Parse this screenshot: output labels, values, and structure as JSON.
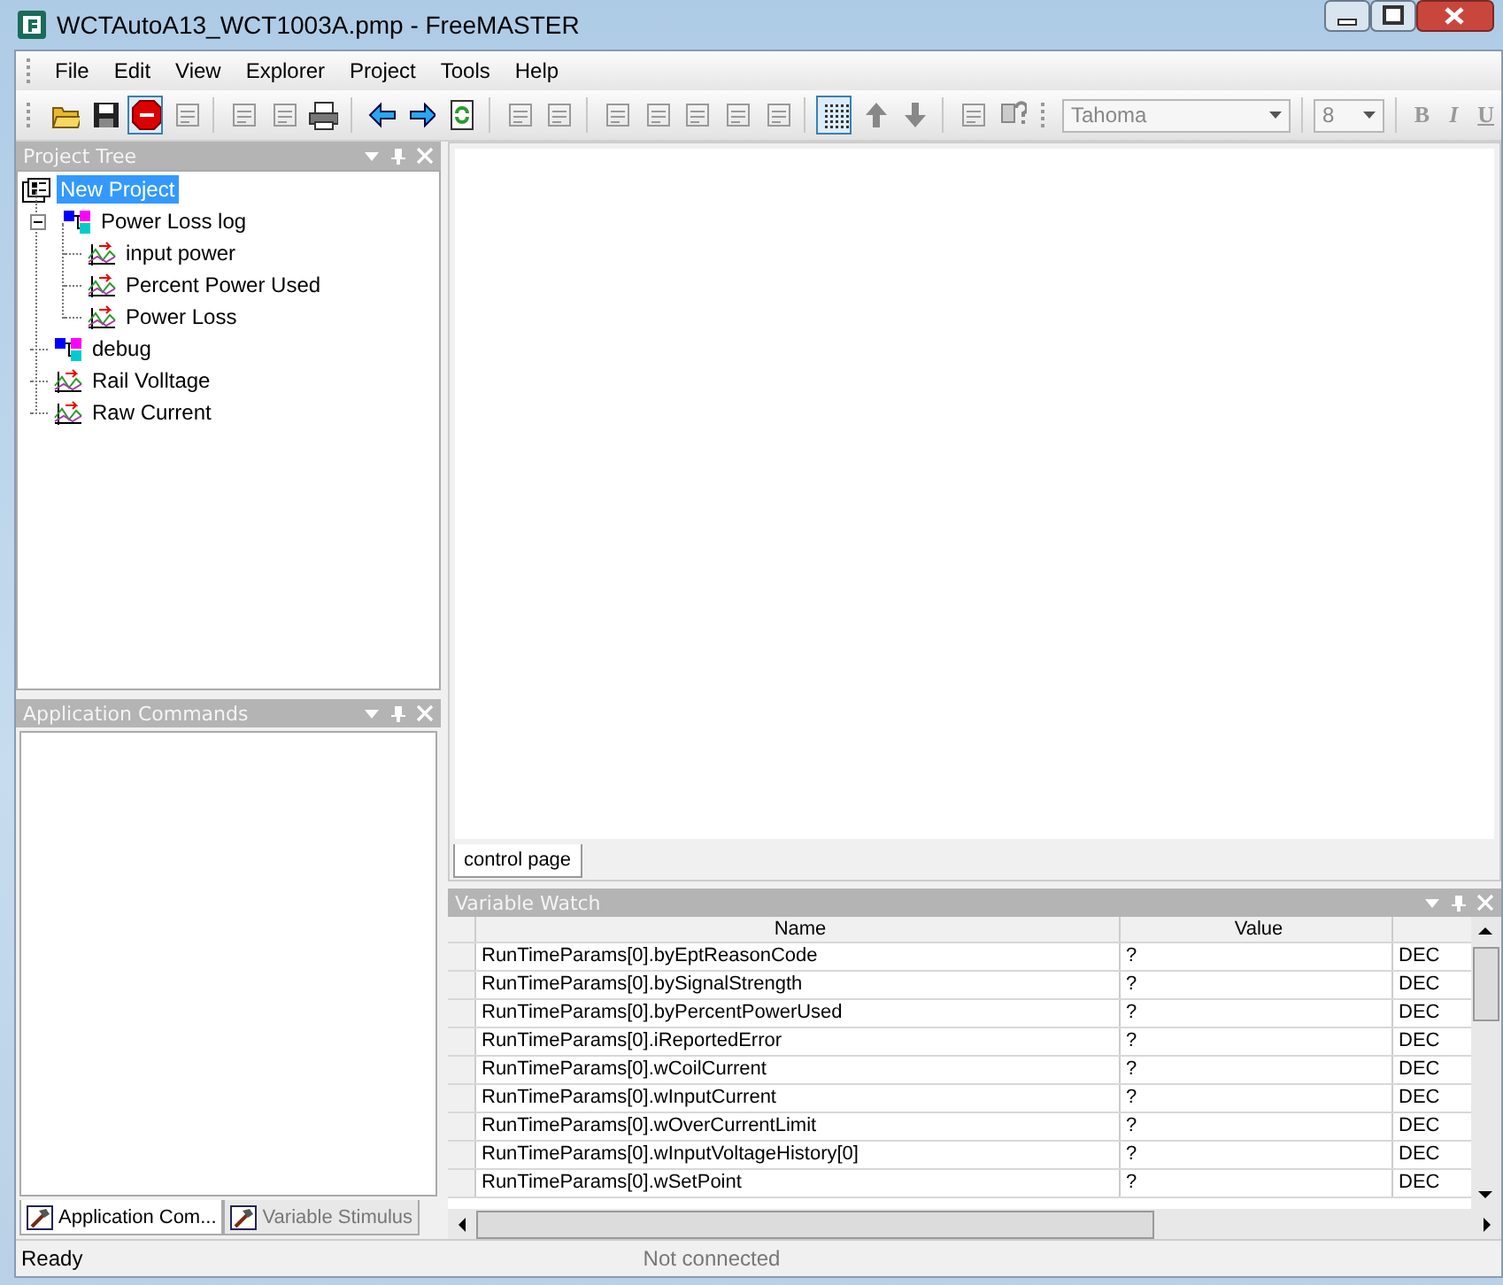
{
  "window": {
    "title": "WCTAutoA13_WCT1003A.pmp - FreeMASTER"
  },
  "menu": [
    "File",
    "Edit",
    "View",
    "Explorer",
    "Project",
    "Tools",
    "Help"
  ],
  "toolbar": {
    "font": "Tahoma",
    "size": "8",
    "styles": [
      "B",
      "I",
      "U"
    ]
  },
  "project_tree": {
    "title": "Project Tree",
    "items": [
      {
        "label": "New Project",
        "kind": "project",
        "selected": true,
        "children": [
          {
            "label": "Power Loss log",
            "kind": "group",
            "selected": false,
            "expanded": true,
            "children": [
              {
                "label": "input power",
                "kind": "recorder",
                "selected": false
              },
              {
                "label": "Percent Power Used",
                "kind": "recorder",
                "selected": false
              },
              {
                "label": "Power Loss",
                "kind": "recorder",
                "selected": false
              }
            ]
          },
          {
            "label": "debug",
            "kind": "group",
            "selected": false
          },
          {
            "label": "Rail Volltage",
            "kind": "recorder",
            "selected": false
          },
          {
            "label": "Raw Current",
            "kind": "recorder",
            "selected": false
          }
        ]
      }
    ]
  },
  "application_commands": {
    "title": "Application Commands",
    "tabs": [
      {
        "label": "Application Com...",
        "selected": true
      },
      {
        "label": "Variable Stimulus",
        "selected": false
      }
    ]
  },
  "document_tabs": [
    {
      "label": "control page",
      "selected": true
    }
  ],
  "variable_watch": {
    "title": "Variable Watch",
    "columns": [
      "Name",
      "Value"
    ],
    "rows": [
      {
        "name": "RunTimeParams[0].byEptReasonCode",
        "value": "?",
        "format": "DEC"
      },
      {
        "name": "RunTimeParams[0].bySignalStrength",
        "value": "?",
        "format": "DEC"
      },
      {
        "name": "RunTimeParams[0].byPercentPowerUsed",
        "value": "?",
        "format": "DEC"
      },
      {
        "name": "RunTimeParams[0].iReportedError",
        "value": "?",
        "format": "DEC"
      },
      {
        "name": "RunTimeParams[0].wCoilCurrent",
        "value": "?",
        "format": "DEC"
      },
      {
        "name": "RunTimeParams[0].wInputCurrent",
        "value": "?",
        "format": "DEC"
      },
      {
        "name": "RunTimeParams[0].wOverCurrentLimit",
        "value": "?",
        "format": "DEC"
      },
      {
        "name": "RunTimeParams[0].wInputVoltageHistory[0]",
        "value": "?",
        "format": "DEC"
      },
      {
        "name": "RunTimeParams[0].wSetPoint",
        "value": "?",
        "format": "DEC"
      }
    ]
  },
  "status_bar": {
    "left": "Ready",
    "connection": "Not connected"
  }
}
